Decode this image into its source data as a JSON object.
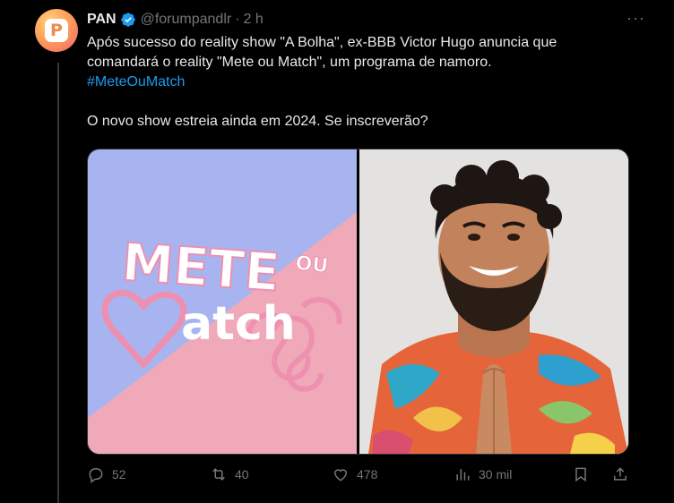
{
  "tweet": {
    "author_name": "PAN",
    "handle": "@forumpandlr",
    "separator": "·",
    "time": "2 h",
    "more": "···",
    "avatar_letter": "P",
    "text_line1": "Após sucesso do reality show \"A Bolha\", ex-BBB Victor Hugo anuncia que",
    "text_line2": "comandará o reality \"Mete ou Match\", um programa de namoro.",
    "hashtag": "#MeteOuMatch",
    "question": "O novo show estreia ainda em 2024. Se inscreverão?"
  },
  "media": {
    "logo_word1": "METE",
    "logo_word2": "OU",
    "logo_word3": "atch"
  },
  "actions": {
    "replies": "52",
    "reposts": "40",
    "likes": "478",
    "views": "30 mil"
  },
  "colors": {
    "accent": "#1d9bf0",
    "muted": "#71767b",
    "logo_pink": "#f0a9b8",
    "logo_blue": "#a8b4f0"
  }
}
